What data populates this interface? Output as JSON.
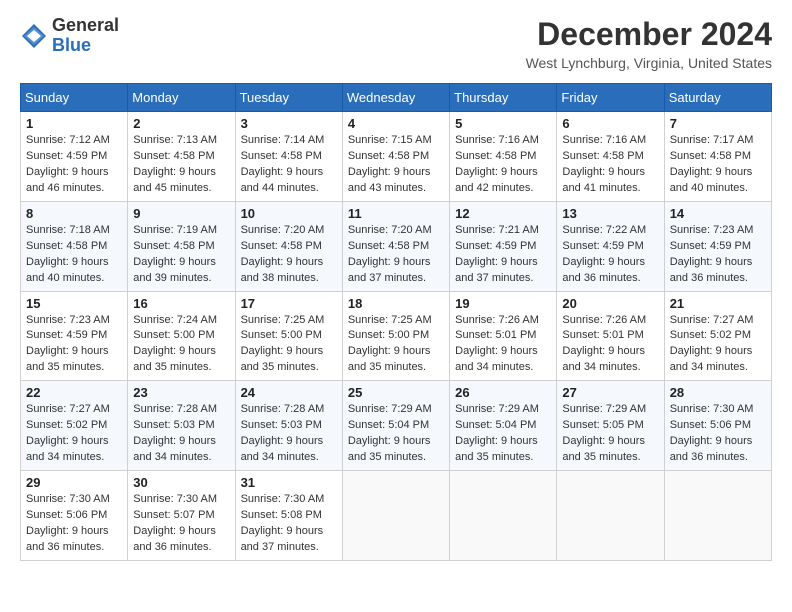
{
  "logo": {
    "general": "General",
    "blue": "Blue"
  },
  "title": "December 2024",
  "location": "West Lynchburg, Virginia, United States",
  "days_of_week": [
    "Sunday",
    "Monday",
    "Tuesday",
    "Wednesday",
    "Thursday",
    "Friday",
    "Saturday"
  ],
  "weeks": [
    [
      {
        "day": "1",
        "sunrise": "7:12 AM",
        "sunset": "4:59 PM",
        "daylight": "9 hours and 46 minutes."
      },
      {
        "day": "2",
        "sunrise": "7:13 AM",
        "sunset": "4:58 PM",
        "daylight": "9 hours and 45 minutes."
      },
      {
        "day": "3",
        "sunrise": "7:14 AM",
        "sunset": "4:58 PM",
        "daylight": "9 hours and 44 minutes."
      },
      {
        "day": "4",
        "sunrise": "7:15 AM",
        "sunset": "4:58 PM",
        "daylight": "9 hours and 43 minutes."
      },
      {
        "day": "5",
        "sunrise": "7:16 AM",
        "sunset": "4:58 PM",
        "daylight": "9 hours and 42 minutes."
      },
      {
        "day": "6",
        "sunrise": "7:16 AM",
        "sunset": "4:58 PM",
        "daylight": "9 hours and 41 minutes."
      },
      {
        "day": "7",
        "sunrise": "7:17 AM",
        "sunset": "4:58 PM",
        "daylight": "9 hours and 40 minutes."
      }
    ],
    [
      {
        "day": "8",
        "sunrise": "7:18 AM",
        "sunset": "4:58 PM",
        "daylight": "9 hours and 40 minutes."
      },
      {
        "day": "9",
        "sunrise": "7:19 AM",
        "sunset": "4:58 PM",
        "daylight": "9 hours and 39 minutes."
      },
      {
        "day": "10",
        "sunrise": "7:20 AM",
        "sunset": "4:58 PM",
        "daylight": "9 hours and 38 minutes."
      },
      {
        "day": "11",
        "sunrise": "7:20 AM",
        "sunset": "4:58 PM",
        "daylight": "9 hours and 37 minutes."
      },
      {
        "day": "12",
        "sunrise": "7:21 AM",
        "sunset": "4:59 PM",
        "daylight": "9 hours and 37 minutes."
      },
      {
        "day": "13",
        "sunrise": "7:22 AM",
        "sunset": "4:59 PM",
        "daylight": "9 hours and 36 minutes."
      },
      {
        "day": "14",
        "sunrise": "7:23 AM",
        "sunset": "4:59 PM",
        "daylight": "9 hours and 36 minutes."
      }
    ],
    [
      {
        "day": "15",
        "sunrise": "7:23 AM",
        "sunset": "4:59 PM",
        "daylight": "9 hours and 35 minutes."
      },
      {
        "day": "16",
        "sunrise": "7:24 AM",
        "sunset": "5:00 PM",
        "daylight": "9 hours and 35 minutes."
      },
      {
        "day": "17",
        "sunrise": "7:25 AM",
        "sunset": "5:00 PM",
        "daylight": "9 hours and 35 minutes."
      },
      {
        "day": "18",
        "sunrise": "7:25 AM",
        "sunset": "5:00 PM",
        "daylight": "9 hours and 35 minutes."
      },
      {
        "day": "19",
        "sunrise": "7:26 AM",
        "sunset": "5:01 PM",
        "daylight": "9 hours and 34 minutes."
      },
      {
        "day": "20",
        "sunrise": "7:26 AM",
        "sunset": "5:01 PM",
        "daylight": "9 hours and 34 minutes."
      },
      {
        "day": "21",
        "sunrise": "7:27 AM",
        "sunset": "5:02 PM",
        "daylight": "9 hours and 34 minutes."
      }
    ],
    [
      {
        "day": "22",
        "sunrise": "7:27 AM",
        "sunset": "5:02 PM",
        "daylight": "9 hours and 34 minutes."
      },
      {
        "day": "23",
        "sunrise": "7:28 AM",
        "sunset": "5:03 PM",
        "daylight": "9 hours and 34 minutes."
      },
      {
        "day": "24",
        "sunrise": "7:28 AM",
        "sunset": "5:03 PM",
        "daylight": "9 hours and 34 minutes."
      },
      {
        "day": "25",
        "sunrise": "7:29 AM",
        "sunset": "5:04 PM",
        "daylight": "9 hours and 35 minutes."
      },
      {
        "day": "26",
        "sunrise": "7:29 AM",
        "sunset": "5:04 PM",
        "daylight": "9 hours and 35 minutes."
      },
      {
        "day": "27",
        "sunrise": "7:29 AM",
        "sunset": "5:05 PM",
        "daylight": "9 hours and 35 minutes."
      },
      {
        "day": "28",
        "sunrise": "7:30 AM",
        "sunset": "5:06 PM",
        "daylight": "9 hours and 36 minutes."
      }
    ],
    [
      {
        "day": "29",
        "sunrise": "7:30 AM",
        "sunset": "5:06 PM",
        "daylight": "9 hours and 36 minutes."
      },
      {
        "day": "30",
        "sunrise": "7:30 AM",
        "sunset": "5:07 PM",
        "daylight": "9 hours and 36 minutes."
      },
      {
        "day": "31",
        "sunrise": "7:30 AM",
        "sunset": "5:08 PM",
        "daylight": "9 hours and 37 minutes."
      },
      null,
      null,
      null,
      null
    ]
  ],
  "labels": {
    "sunrise": "Sunrise:",
    "sunset": "Sunset:",
    "daylight": "Daylight:"
  }
}
